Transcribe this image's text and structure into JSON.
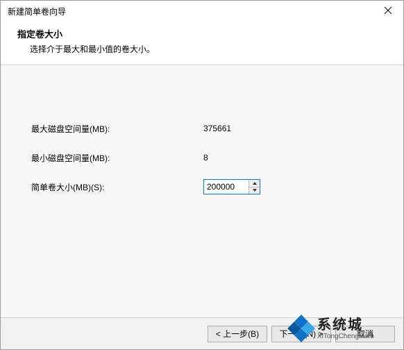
{
  "titlebar": {
    "title": "新建简单卷向导"
  },
  "header": {
    "title": "指定卷大小",
    "subtitle": "选择介于最大和最小值的卷大小。"
  },
  "fields": {
    "max_label": "最大磁盘空间量(MB):",
    "max_value": "375661",
    "min_label": "最小磁盘空间量(MB):",
    "min_value": "8",
    "size_label": "简单卷大小(MB)(S):",
    "size_value": "200000"
  },
  "footer": {
    "back": "< 上一步(B)",
    "next": "下一步(N) >",
    "cancel": "取消"
  },
  "watermark": {
    "cn": "系统城",
    "en": "XiTongCheng.com"
  }
}
